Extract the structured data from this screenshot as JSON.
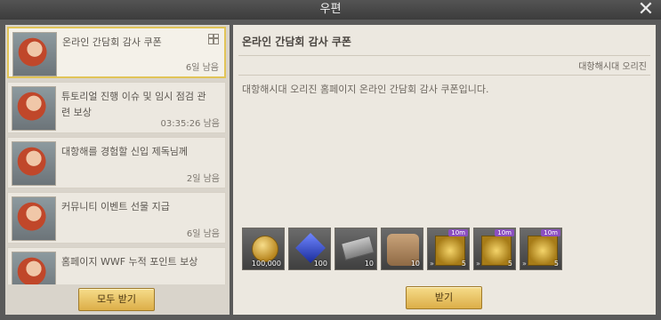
{
  "window": {
    "title": "우편"
  },
  "mail_list": {
    "items": [
      {
        "title": "온라인 간담회 감사 쿠폰",
        "time": "6일 남음",
        "selected": true
      },
      {
        "title": "튜토리얼 진행 이슈 및 임시 점검 관련 보상",
        "time": "03:35:26 남음",
        "selected": false
      },
      {
        "title": "대항해를 경험할 신입 제독님께",
        "time": "2일 남음",
        "selected": false
      },
      {
        "title": "커뮤니티 이벤트 선물 지급",
        "time": "6일 남음",
        "selected": false
      },
      {
        "title": "홈페이지 WWF 누적 포인트 보상",
        "time": "",
        "selected": false
      }
    ],
    "receive_all_label": "모두 받기"
  },
  "detail": {
    "title": "온라인 간담회 감사 쿠폰",
    "sender": "대항해시대 오리진",
    "body": "대항해시대 오리진 홈페이지 온라인 간담회 감사 쿠폰입니다.",
    "receive_label": "받기",
    "rewards": [
      {
        "icon": "gold-coin-icon",
        "qty": "100,000",
        "tag": ""
      },
      {
        "icon": "blue-gem-icon",
        "qty": "100",
        "tag": ""
      },
      {
        "icon": "ticket-icon",
        "qty": "10",
        "tag": ""
      },
      {
        "icon": "map-item-icon",
        "qty": "10",
        "tag": ""
      },
      {
        "icon": "speed-scroll-icon",
        "qty": "5",
        "tag": "10m"
      },
      {
        "icon": "speed-scroll-icon",
        "qty": "5",
        "tag": "10m"
      },
      {
        "icon": "speed-scroll-icon",
        "qty": "5",
        "tag": "10m"
      }
    ]
  }
}
